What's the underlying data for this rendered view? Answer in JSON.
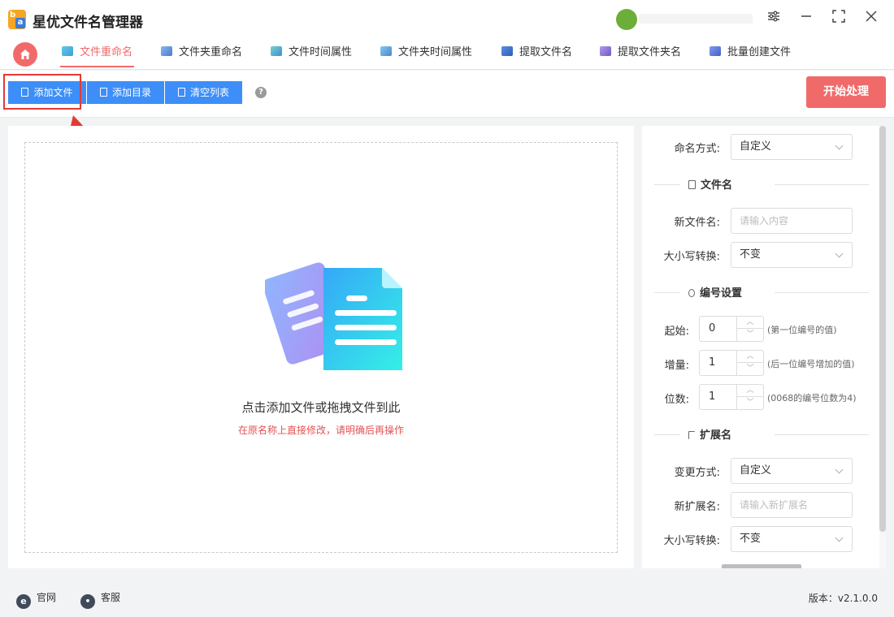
{
  "app": {
    "title": "星优文件名管理器"
  },
  "nav": {
    "tabs": [
      {
        "label": "文件重命名",
        "active": true,
        "icon": "file-rename-icon"
      },
      {
        "label": "文件夹重命名",
        "icon": "folder-rename-icon"
      },
      {
        "label": "文件时间属性",
        "icon": "file-time-icon"
      },
      {
        "label": "文件夹时间属性",
        "icon": "folder-time-icon"
      },
      {
        "label": "提取文件名",
        "icon": "extract-filename-icon"
      },
      {
        "label": "提取文件夹名",
        "icon": "extract-foldername-icon"
      },
      {
        "label": "批量创建文件",
        "icon": "batch-create-icon"
      }
    ]
  },
  "toolbar": {
    "add_file": "添加文件",
    "add_dir": "添加目录",
    "clear_list": "清空列表",
    "help": "?",
    "start": "开始处理"
  },
  "dropzone": {
    "title": "点击添加文件或拖拽文件到此",
    "note": "在原名称上直接修改，请明确后再操作"
  },
  "settings": {
    "naming_mode_label": "命名方式:",
    "naming_mode_value": "自定义",
    "section_filename": "文件名",
    "new_filename_label": "新文件名:",
    "new_filename_placeholder": "请输入内容",
    "case_label": "大小写转换:",
    "case_value": "不变",
    "section_number": "编号设置",
    "start_label": "起始:",
    "start_value": "0",
    "start_hint": "(第一位编号的值)",
    "step_label": "增量:",
    "step_value": "1",
    "step_hint": "(后一位编号增加的值)",
    "digits_label": "位数:",
    "digits_value": "1",
    "digits_hint": "(0068的编号位数为4)",
    "section_ext": "扩展名",
    "ext_mode_label": "变更方式:",
    "ext_mode_value": "自定义",
    "new_ext_label": "新扩展名:",
    "new_ext_placeholder": "请输入新扩展名",
    "ext_case_label": "大小写转换:",
    "ext_case_value": "不变"
  },
  "footer": {
    "website": "官网",
    "support": "客服",
    "version": "版本：v2.1.0.0"
  },
  "colors": {
    "primary_blue": "#3d8ef8",
    "accent_red": "#f16a6a",
    "highlight_red": "#e53935"
  }
}
